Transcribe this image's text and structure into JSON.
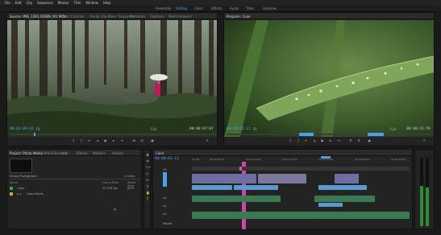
{
  "menu": [
    "File",
    "Edit",
    "Clip",
    "Sequence",
    "Marker",
    "Title",
    "Window",
    "Help"
  ],
  "workspaces": {
    "items": [
      "Assembly",
      "Editing",
      "Color",
      "Effects",
      "Audio",
      "Titles",
      "Libraries"
    ],
    "active": "Editing"
  },
  "source_monitor": {
    "tabs": [
      "Source: IMG_1283_ROBIN_W1.MOV",
      "Effect Controls",
      "Audio Clip Mixer: Sequence",
      "Metadata",
      "Captions",
      "Media Browser"
    ],
    "timecode_in": "00:01:09:42",
    "zoom": "Fit",
    "fraction": "Full",
    "timecode_duration": "00:00:07:07"
  },
  "program_monitor": {
    "tabs": [
      "Program: Color"
    ],
    "timecode_in": "00:00:01:11",
    "zoom": "Fit",
    "fraction": "Full",
    "timecode_duration": "00:00:41:59"
  },
  "project_panel": {
    "tabs": [
      "Project: Photo Media",
      "Media Browser",
      "Info",
      "Effects",
      "Markers",
      "History"
    ],
    "item_count": "2 items",
    "sequence_name": "Sheep Photography",
    "columns": [
      "Name",
      "Frame Rate",
      "Media Start"
    ],
    "rows": [
      {
        "name": "Color",
        "rate": "23.976 fps",
        "start": "00:0"
      },
      {
        "name": "Color Media",
        "rate": "",
        "start": ""
      }
    ]
  },
  "timeline": {
    "tab": "Color",
    "timecode": "00:00:01:11",
    "ruler": [
      "00:00",
      "00:00:05:00",
      "00:00:10:00",
      "00:00:15:00",
      "00:00:20:00",
      "00:00:25:00",
      "00:00:30:00"
    ],
    "tracks": [
      "V3",
      "V2",
      "V1",
      "A1",
      "A2",
      "A3",
      "Master"
    ]
  },
  "colors": {
    "accent_blue": "#4d9df0",
    "video_clip": "#6f6ea0",
    "audio_clip": "#3a7a52",
    "selected_clip": "#5a9ad0"
  }
}
